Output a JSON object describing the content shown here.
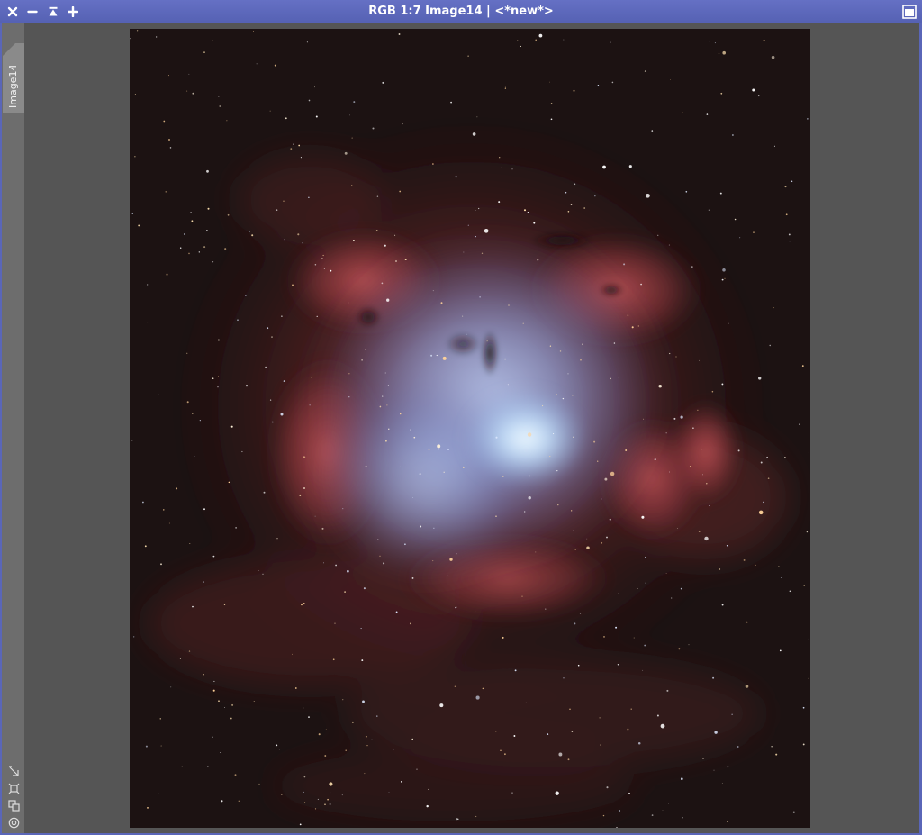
{
  "window": {
    "title": "RGB 1:7 Image14 | <*new*>"
  },
  "titlebar": {
    "buttons": [
      {
        "name": "close",
        "icon": "close-icon"
      },
      {
        "name": "minimize",
        "icon": "minimize-icon"
      },
      {
        "name": "shade",
        "icon": "shade-icon"
      },
      {
        "name": "zoom-in",
        "icon": "plus-icon"
      }
    ],
    "maximize_icon": "maximize-icon"
  },
  "sidebar": {
    "tab_label": "Image14",
    "icons": [
      "fit-view-icon",
      "zoom-to-fit-icon",
      "clone-icon",
      "target-icon"
    ]
  },
  "image": {
    "description_colors": {
      "background": "#1c1212",
      "nebula_red": "#b8474a",
      "nebula_blue": "#9fb4e6",
      "core_cyan": "#d8f0ff"
    },
    "zoom": "1:7",
    "mode": "RGB"
  },
  "colors": {
    "titlebar": "#5a66b8",
    "sidebar": "#6d6d6d",
    "viewport": "#555555"
  }
}
